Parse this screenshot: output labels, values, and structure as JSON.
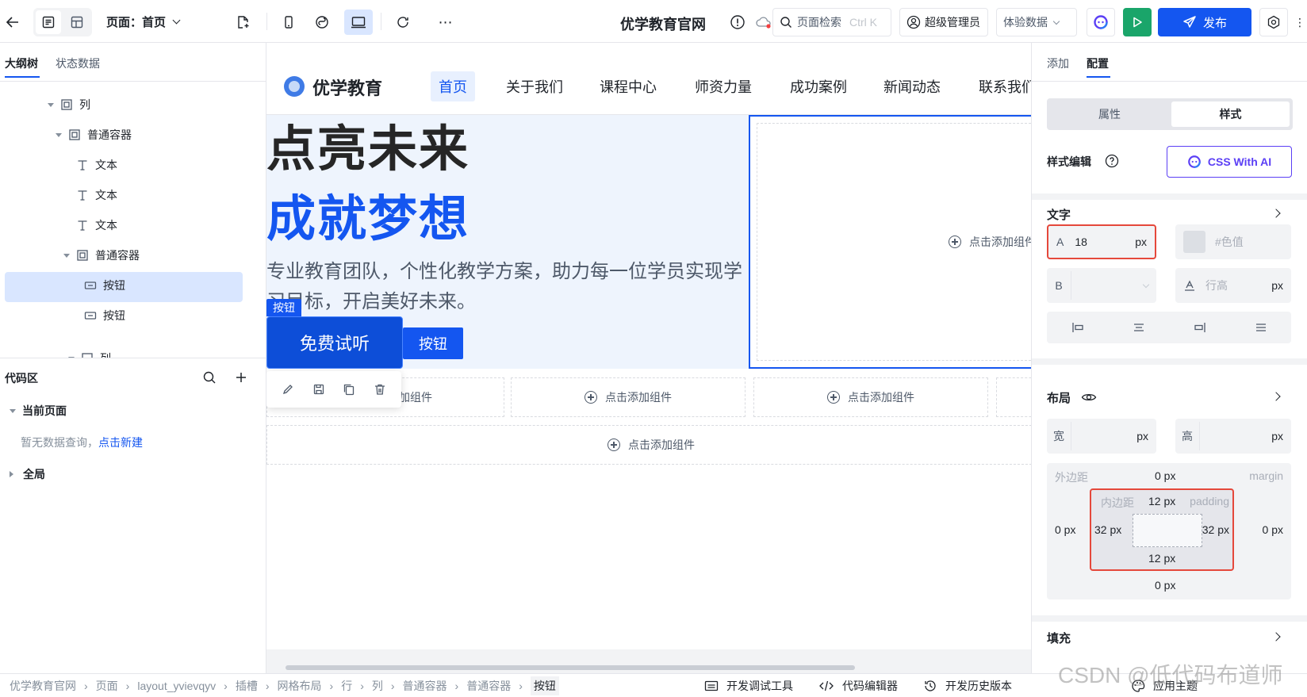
{
  "header": {
    "page_label": "页面：首页",
    "site_title": "优学教育官网",
    "search_placeholder": "页面检索",
    "search_shortcut": "Ctrl K",
    "user_role": "超级管理员",
    "data_mode": "体验数据",
    "publish_label": "发布"
  },
  "left_panel": {
    "tabs": [
      "大纲树",
      "状态数据"
    ],
    "tree": [
      {
        "label": "列",
        "type": "container"
      },
      {
        "label": "普通容器",
        "type": "container"
      },
      {
        "label": "文本",
        "type": "text"
      },
      {
        "label": "文本",
        "type": "text"
      },
      {
        "label": "文本",
        "type": "text"
      },
      {
        "label": "普通容器",
        "type": "container"
      },
      {
        "label": "按钮",
        "type": "button"
      },
      {
        "label": "按钮",
        "type": "button"
      },
      {
        "label": "列",
        "type": "container"
      }
    ],
    "code_area": {
      "title": "代码区",
      "current_page": "当前页面",
      "empty_text": "暂无数据查询，",
      "create_link": "点击新建",
      "global": "全局"
    }
  },
  "canvas": {
    "brand": "优学教育",
    "nav": [
      "首页",
      "关于我们",
      "课程中心",
      "师资力量",
      "成功案例",
      "新闻动态",
      "联系我们"
    ],
    "hero_line1": "点亮未来",
    "hero_line2": "成就梦想",
    "hero_desc": "专业教育团队，个性化教学方案，助力每一位学员实现学习目标，开启美好未来。",
    "selected_tag": "按钮",
    "primary_button": "免费试听",
    "secondary_button": "按钮",
    "add_component": "点击添加组件"
  },
  "right_panel": {
    "tabs": [
      "添加",
      "配置"
    ],
    "mode_tabs": [
      "属性",
      "样式"
    ],
    "style_edit_label": "样式编辑",
    "css_ai_label": "CSS With AI",
    "text_section": {
      "title": "文字",
      "font_size_icon": "A",
      "font_size": "18",
      "unit": "px",
      "color_placeholder": "#色值",
      "weight_icon": "B",
      "line_height_placeholder": "行高"
    },
    "layout_section": {
      "title": "布局",
      "width_label": "宽",
      "height_label": "高",
      "margin_label": "外边距",
      "margin_en": "margin",
      "padding_label": "内边距",
      "padding_en": "padding",
      "margin_top": "0 px",
      "margin_left": "0 px",
      "margin_right": "0 px",
      "margin_bottom": "0 px",
      "padding_top": "12 px",
      "padding_left": "32 px",
      "padding_right": "32 px",
      "padding_bottom": "12 px"
    },
    "fill_section": {
      "title": "填充"
    }
  },
  "breadcrumb": [
    "优学教育官网",
    "页面",
    "layout_yvievqyv",
    "插槽",
    "网格布局",
    "行",
    "列",
    "普通容器",
    "普通容器",
    "按钮"
  ],
  "bottom_tools": [
    "开发调试工具",
    "代码编辑器",
    "开发历史版本",
    "应用主题"
  ],
  "watermark": "CSDN @低代码布道师"
}
